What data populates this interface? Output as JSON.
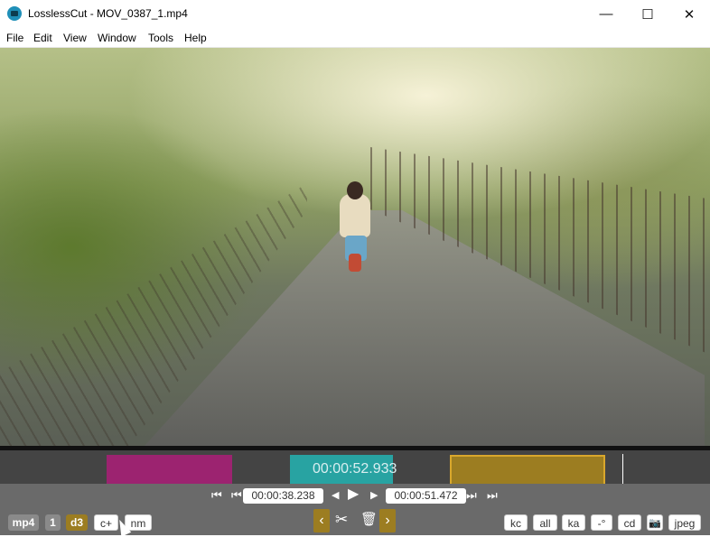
{
  "window": {
    "title": "LosslessCut - MOV_0387_1.mp4",
    "minimize": "—",
    "maximize": "☐",
    "close": "✕"
  },
  "menu": [
    "File",
    "Edit",
    "View",
    "Window",
    "Tools",
    "Help"
  ],
  "timeline": {
    "current_time": "00:00:52.933",
    "segment_colors": [
      "#9c2370",
      "#28a3a2",
      "#9c7d21"
    ]
  },
  "playback": {
    "jump_start_icon": "skip-to-start-icon",
    "cut_start_time": "00:00:38.238",
    "cut_end_time": "00:00:51.472",
    "jump_end_icon": "skip-to-end-icon"
  },
  "bottom_left": {
    "format": "mp4",
    "count": "1",
    "d3": "d3",
    "cplus": "c+",
    "nm": "nm"
  },
  "bottom_right": {
    "kc": "kc",
    "all": "all",
    "ka": "ka",
    "rotate": "-°",
    "cd": "cd",
    "jpeg": "jpeg"
  },
  "colors": {
    "accent_gold": "#9c7d21",
    "magenta": "#9c2370",
    "teal": "#28a3a2",
    "control_bg": "#6a6a6a",
    "timeline_bg": "#444444"
  }
}
